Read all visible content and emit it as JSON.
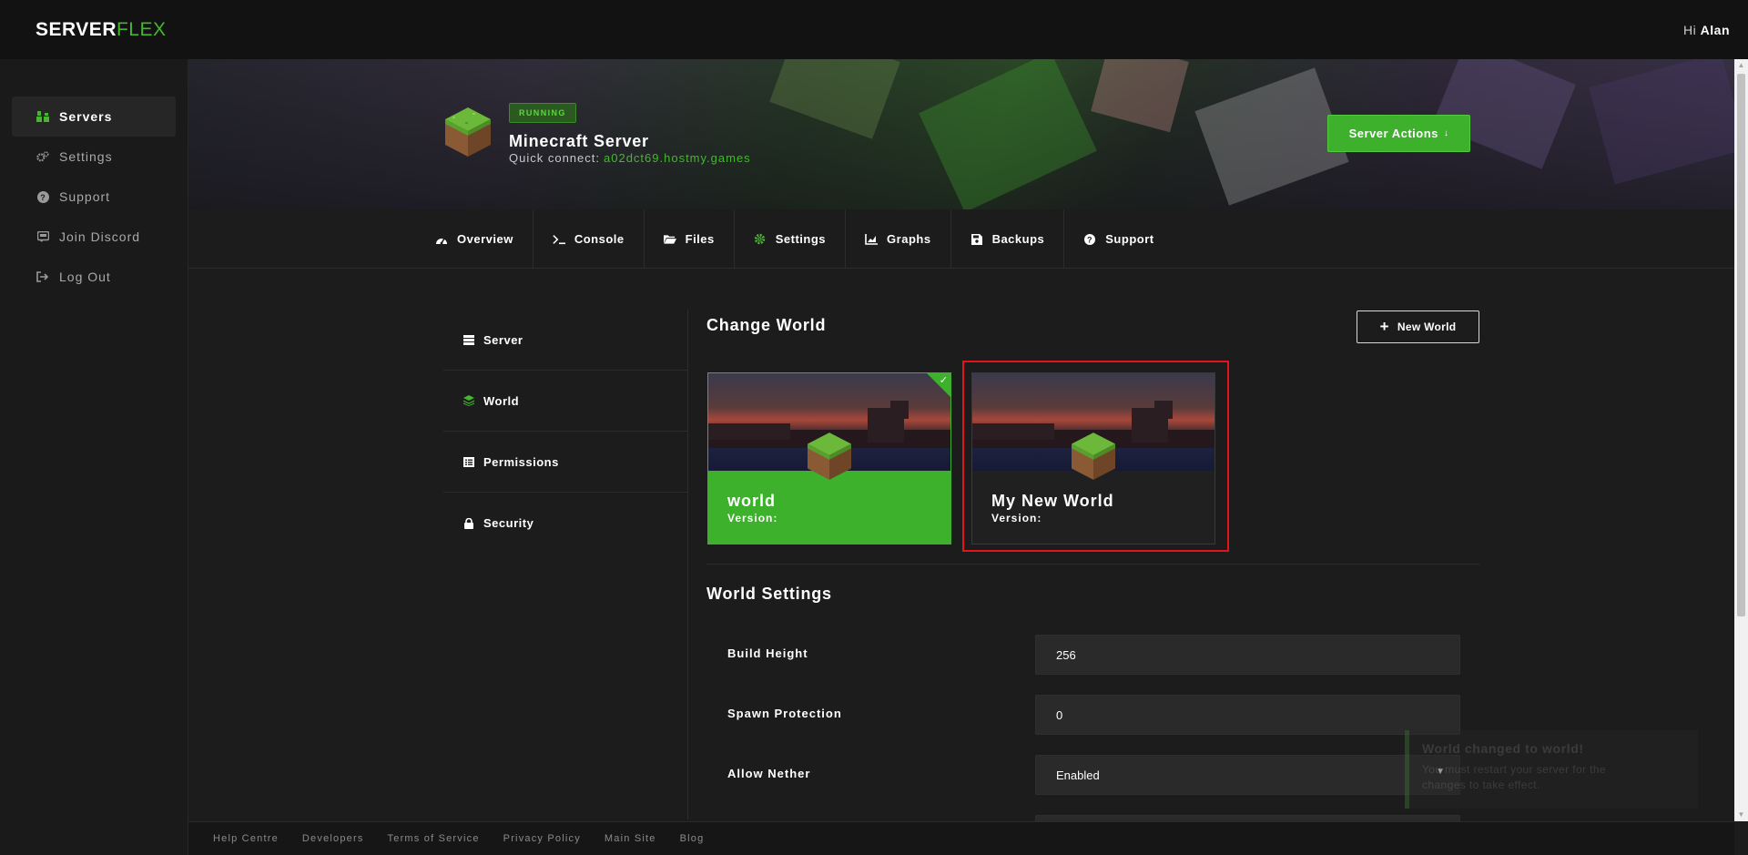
{
  "header": {
    "logo_part1": "SERVER",
    "logo_part2": "FLEX",
    "greeting_prefix": "Hi",
    "user_name": "Alan"
  },
  "sidebar": {
    "items": [
      {
        "label": "Servers",
        "icon": "servers-icon",
        "active": true
      },
      {
        "label": "Settings",
        "icon": "gears-icon"
      },
      {
        "label": "Support",
        "icon": "question-icon"
      },
      {
        "label": "Join Discord",
        "icon": "discord-icon"
      },
      {
        "label": "Log Out",
        "icon": "logout-icon"
      }
    ]
  },
  "server": {
    "status": "RUNNING",
    "name": "Minecraft Server",
    "quick_connect_label": "Quick connect:",
    "address": "a02dct69.hostmy.games",
    "actions_label": "Server Actions"
  },
  "tabs": [
    {
      "label": "Overview",
      "icon": "dashboard-icon"
    },
    {
      "label": "Console",
      "icon": "terminal-icon"
    },
    {
      "label": "Files",
      "icon": "folder-icon"
    },
    {
      "label": "Settings",
      "icon": "gear-icon",
      "active": true
    },
    {
      "label": "Graphs",
      "icon": "chart-icon"
    },
    {
      "label": "Backups",
      "icon": "save-icon"
    },
    {
      "label": "Support",
      "icon": "question-icon"
    }
  ],
  "settings_menu": [
    {
      "label": "Server",
      "icon": "server-icon"
    },
    {
      "label": "World",
      "icon": "layers-icon",
      "active": true
    },
    {
      "label": "Permissions",
      "icon": "list-icon"
    },
    {
      "label": "Security",
      "icon": "lock-icon"
    }
  ],
  "change_world": {
    "title": "Change World",
    "new_world_label": "New World",
    "worlds": [
      {
        "name": "world",
        "version_label": "Version:",
        "selected": true
      },
      {
        "name": "My New World",
        "version_label": "Version:",
        "selected": false
      }
    ]
  },
  "world_settings": {
    "title": "World Settings",
    "fields": [
      {
        "label": "Build Height",
        "value": "256"
      },
      {
        "label": "Spawn Protection",
        "value": "0"
      },
      {
        "label": "Allow Nether",
        "value": "Enabled"
      }
    ]
  },
  "toast": {
    "title": "World changed to world!",
    "body": "You must restart your server for the changes to take effect."
  },
  "footer": {
    "links": [
      "Help Centre",
      "Developers",
      "Terms of Service",
      "Privacy Policy",
      "Main Site",
      "Blog"
    ]
  },
  "colors": {
    "accent": "#3db02c",
    "highlight": "#e0141a",
    "background": "#1c1c1c"
  }
}
